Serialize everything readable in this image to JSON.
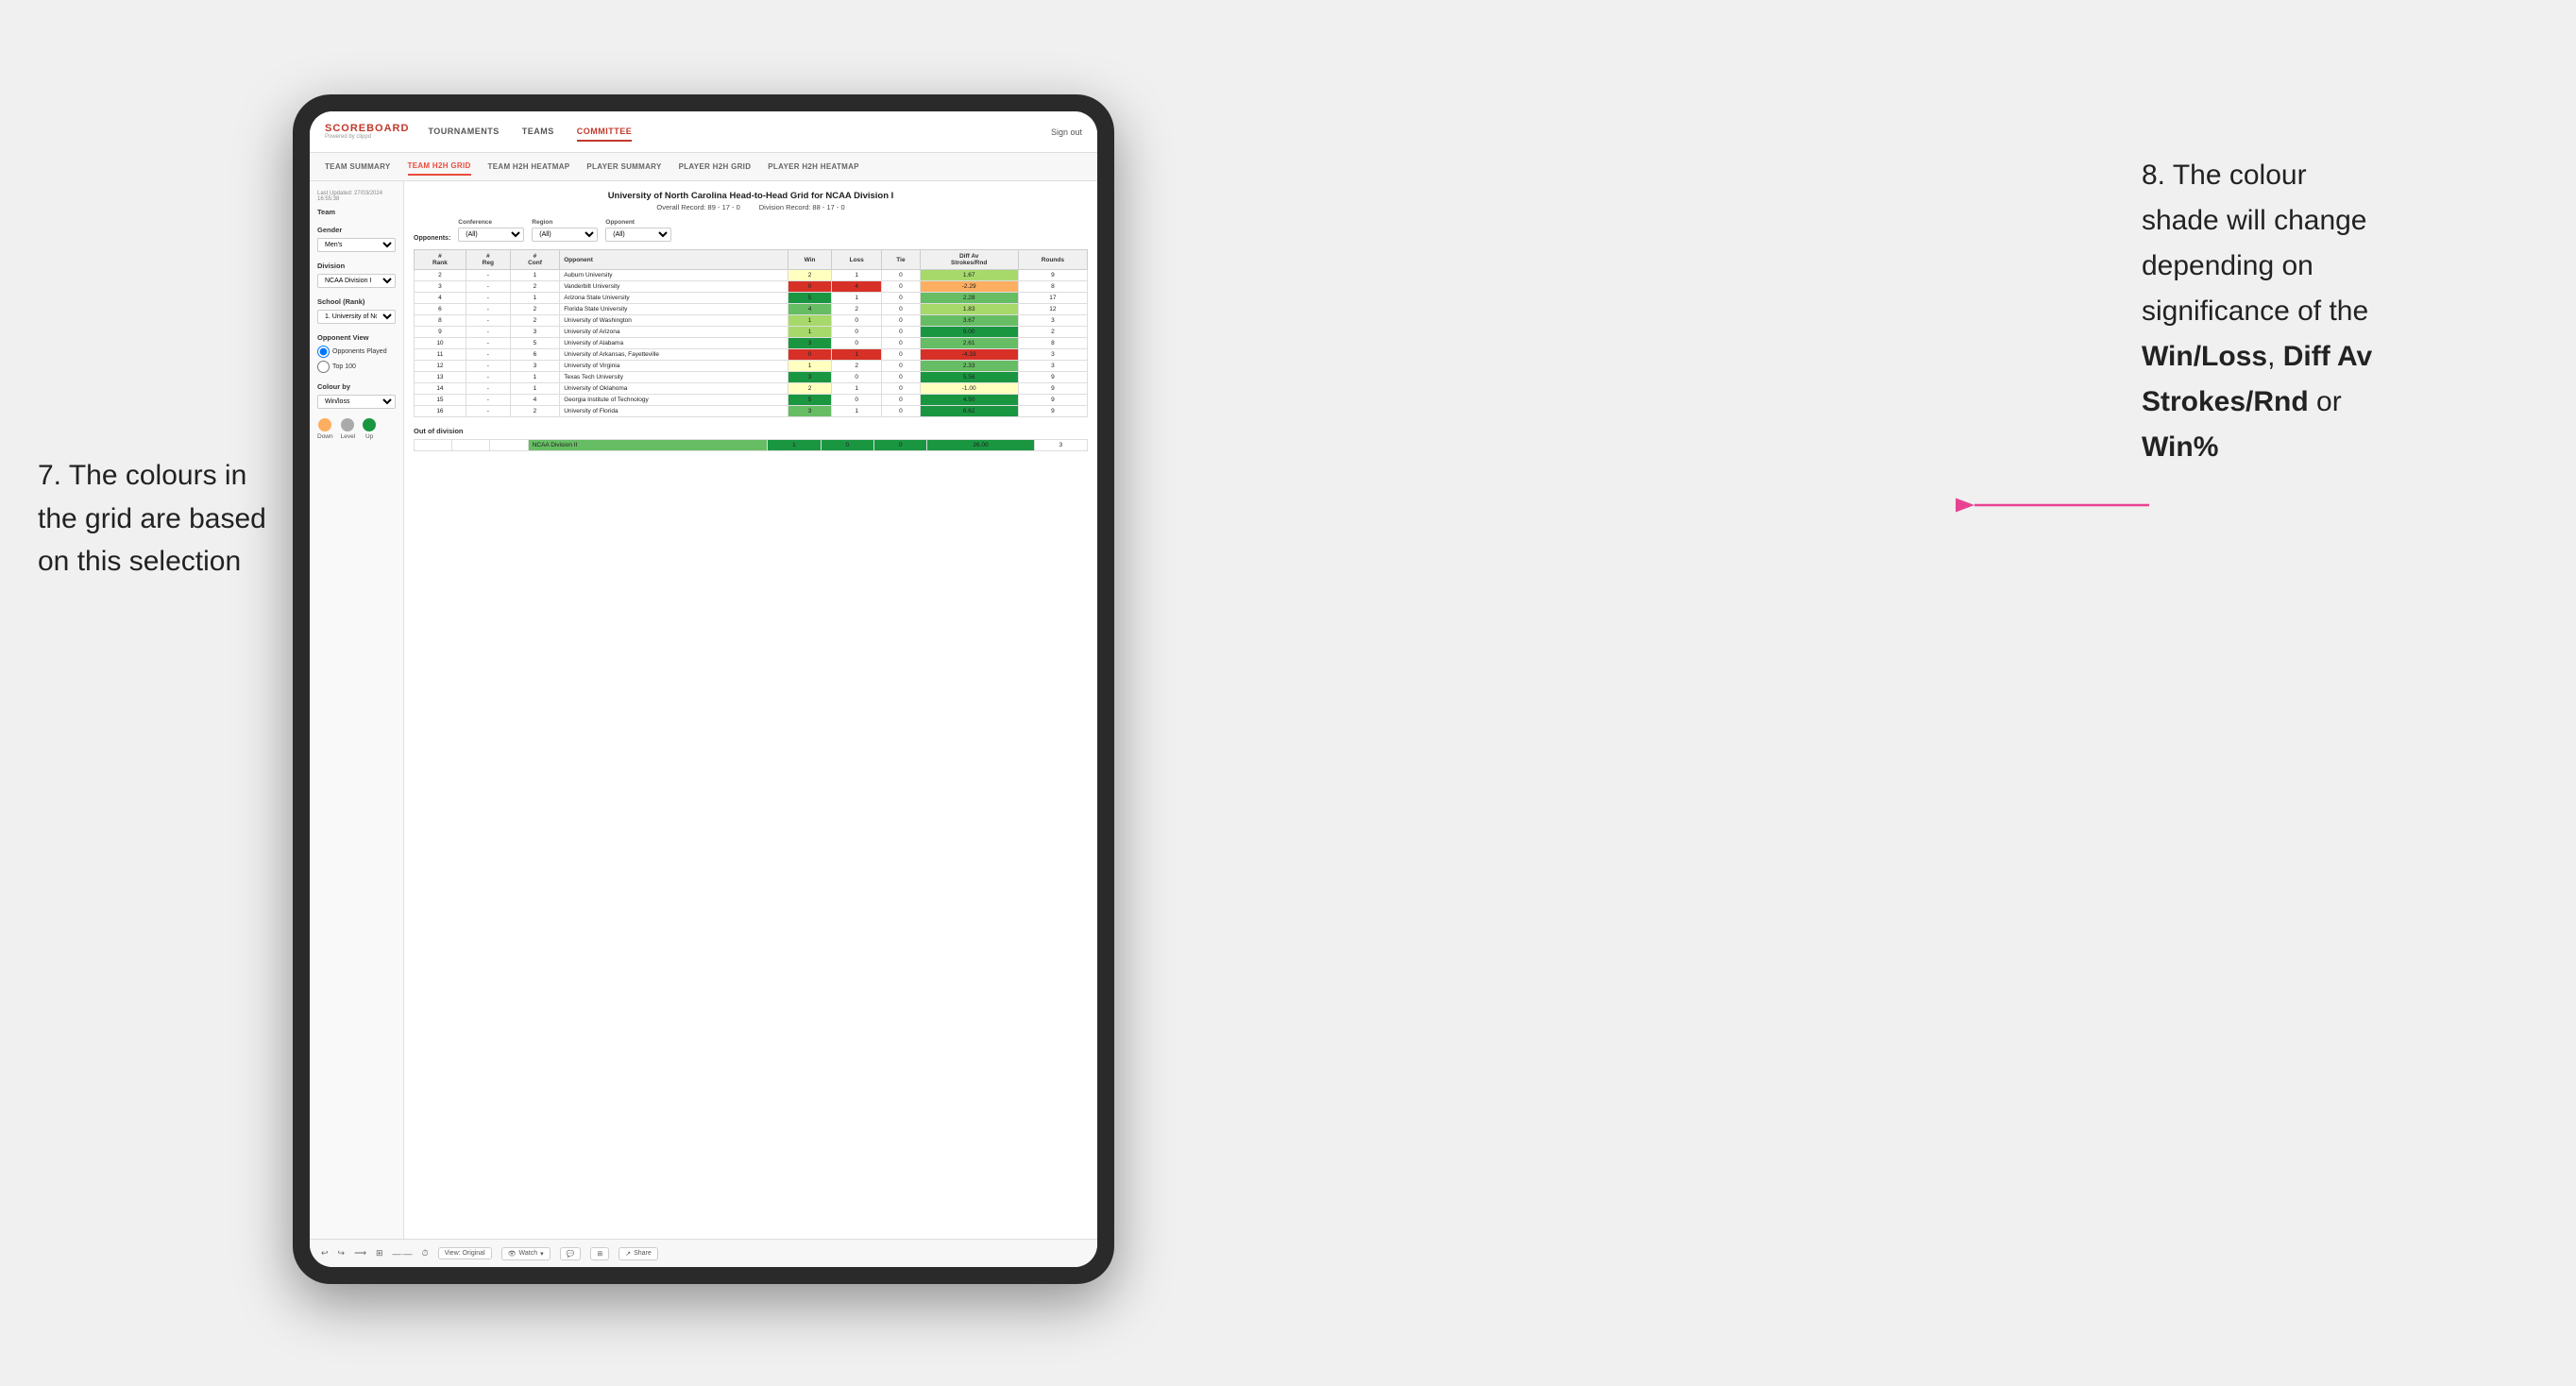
{
  "annotations": {
    "left_number": "7.",
    "left_text": "The colours in\nthe grid are based\non this selection",
    "right_number": "8.",
    "right_text_1": " The colour\nshade will change\ndepending on\nsignificance of the\n",
    "right_bold_1": "Win/Loss",
    "right_text_2": ", ",
    "right_bold_2": "Diff Av\nStrokes/Rnd",
    "right_text_3": " or\n",
    "right_bold_3": "Win%"
  },
  "nav": {
    "logo": "SCOREBOARD",
    "powered_by": "Powered by clippd",
    "items": [
      "TOURNAMENTS",
      "TEAMS",
      "COMMITTEE"
    ],
    "sign_out": "Sign out"
  },
  "sub_nav": {
    "items": [
      "TEAM SUMMARY",
      "TEAM H2H GRID",
      "TEAM H2H HEATMAP",
      "PLAYER SUMMARY",
      "PLAYER H2H GRID",
      "PLAYER H2H HEATMAP"
    ],
    "active": "TEAM H2H GRID"
  },
  "sidebar": {
    "last_updated_label": "Last Updated: 27/03/2024",
    "last_updated_time": "16:55:38",
    "team_label": "Team",
    "gender_label": "Gender",
    "gender_value": "Men's",
    "division_label": "Division",
    "division_value": "NCAA Division I",
    "school_label": "School (Rank)",
    "school_value": "1. University of Nort...",
    "opponent_view_label": "Opponent View",
    "opponents_played": "Opponents Played",
    "top_100": "Top 100",
    "colour_by_label": "Colour by",
    "colour_by_value": "Win/loss",
    "legend": {
      "down": "Down",
      "level": "Level",
      "up": "Up"
    }
  },
  "grid": {
    "title": "University of North Carolina Head-to-Head Grid for NCAA Division I",
    "overall_record": "Overall Record: 89 - 17 - 0",
    "division_record": "Division Record: 88 - 17 - 0",
    "filter_conference_label": "Conference",
    "filter_region_label": "Region",
    "filter_opponent_label": "Opponent",
    "opponents_label": "Opponents:",
    "columns": [
      "#\nRank",
      "#\nReg",
      "#\nConf",
      "Opponent",
      "Win",
      "Loss",
      "Tie",
      "Diff Av\nStrokes/Rnd",
      "Rounds"
    ],
    "rows": [
      {
        "rank": "2",
        "reg": "-",
        "conf": "1",
        "opponent": "Auburn University",
        "win": "2",
        "loss": "1",
        "tie": "0",
        "diff": "1.67",
        "rounds": "9",
        "win_color": "yellow",
        "diff_color": "green-light"
      },
      {
        "rank": "3",
        "reg": "-",
        "conf": "2",
        "opponent": "Vanderbilt University",
        "win": "0",
        "loss": "4",
        "tie": "0",
        "diff": "-2.29",
        "rounds": "8",
        "win_color": "red",
        "diff_color": "orange"
      },
      {
        "rank": "4",
        "reg": "-",
        "conf": "1",
        "opponent": "Arizona State University",
        "win": "5",
        "loss": "1",
        "tie": "0",
        "diff": "2.28",
        "rounds": "17",
        "win_color": "green-dark",
        "diff_color": "green-mid"
      },
      {
        "rank": "6",
        "reg": "-",
        "conf": "2",
        "opponent": "Florida State University",
        "win": "4",
        "loss": "2",
        "tie": "0",
        "diff": "1.83",
        "rounds": "12",
        "win_color": "green-mid",
        "diff_color": "green-light"
      },
      {
        "rank": "8",
        "reg": "-",
        "conf": "2",
        "opponent": "University of Washington",
        "win": "1",
        "loss": "0",
        "tie": "0",
        "diff": "3.67",
        "rounds": "3",
        "win_color": "green-light",
        "diff_color": "green-mid"
      },
      {
        "rank": "9",
        "reg": "-",
        "conf": "3",
        "opponent": "University of Arizona",
        "win": "1",
        "loss": "0",
        "tie": "0",
        "diff": "9.00",
        "rounds": "2",
        "win_color": "green-light",
        "diff_color": "green-dark"
      },
      {
        "rank": "10",
        "reg": "-",
        "conf": "5",
        "opponent": "University of Alabama",
        "win": "3",
        "loss": "0",
        "tie": "0",
        "diff": "2.61",
        "rounds": "8",
        "win_color": "green-dark",
        "diff_color": "green-mid"
      },
      {
        "rank": "11",
        "reg": "-",
        "conf": "6",
        "opponent": "University of Arkansas, Fayetteville",
        "win": "0",
        "loss": "1",
        "tie": "0",
        "diff": "-4.33",
        "rounds": "3",
        "win_color": "red",
        "diff_color": "red"
      },
      {
        "rank": "12",
        "reg": "-",
        "conf": "3",
        "opponent": "University of Virginia",
        "win": "1",
        "loss": "2",
        "tie": "0",
        "diff": "2.33",
        "rounds": "3",
        "win_color": "yellow",
        "diff_color": "green-mid"
      },
      {
        "rank": "13",
        "reg": "-",
        "conf": "1",
        "opponent": "Texas Tech University",
        "win": "3",
        "loss": "0",
        "tie": "0",
        "diff": "5.56",
        "rounds": "9",
        "win_color": "green-dark",
        "diff_color": "green-dark"
      },
      {
        "rank": "14",
        "reg": "-",
        "conf": "1",
        "opponent": "University of Oklahoma",
        "win": "2",
        "loss": "1",
        "tie": "0",
        "diff": "-1.00",
        "rounds": "9",
        "win_color": "yellow",
        "diff_color": "yellow"
      },
      {
        "rank": "15",
        "reg": "-",
        "conf": "4",
        "opponent": "Georgia Institute of Technology",
        "win": "5",
        "loss": "0",
        "tie": "0",
        "diff": "4.50",
        "rounds": "9",
        "win_color": "green-dark",
        "diff_color": "green-dark"
      },
      {
        "rank": "16",
        "reg": "-",
        "conf": "2",
        "opponent": "University of Florida",
        "win": "3",
        "loss": "1",
        "tie": "0",
        "diff": "6.62",
        "rounds": "9",
        "win_color": "green-mid",
        "diff_color": "green-dark"
      }
    ],
    "out_of_division_label": "Out of division",
    "out_of_division_row": {
      "opponent": "NCAA Division II",
      "win": "1",
      "loss": "0",
      "tie": "0",
      "diff": "26.00",
      "rounds": "3",
      "diff_color": "green-dark"
    }
  },
  "toolbar": {
    "view_label": "View: Original",
    "watch_label": "Watch",
    "share_label": "Share"
  }
}
